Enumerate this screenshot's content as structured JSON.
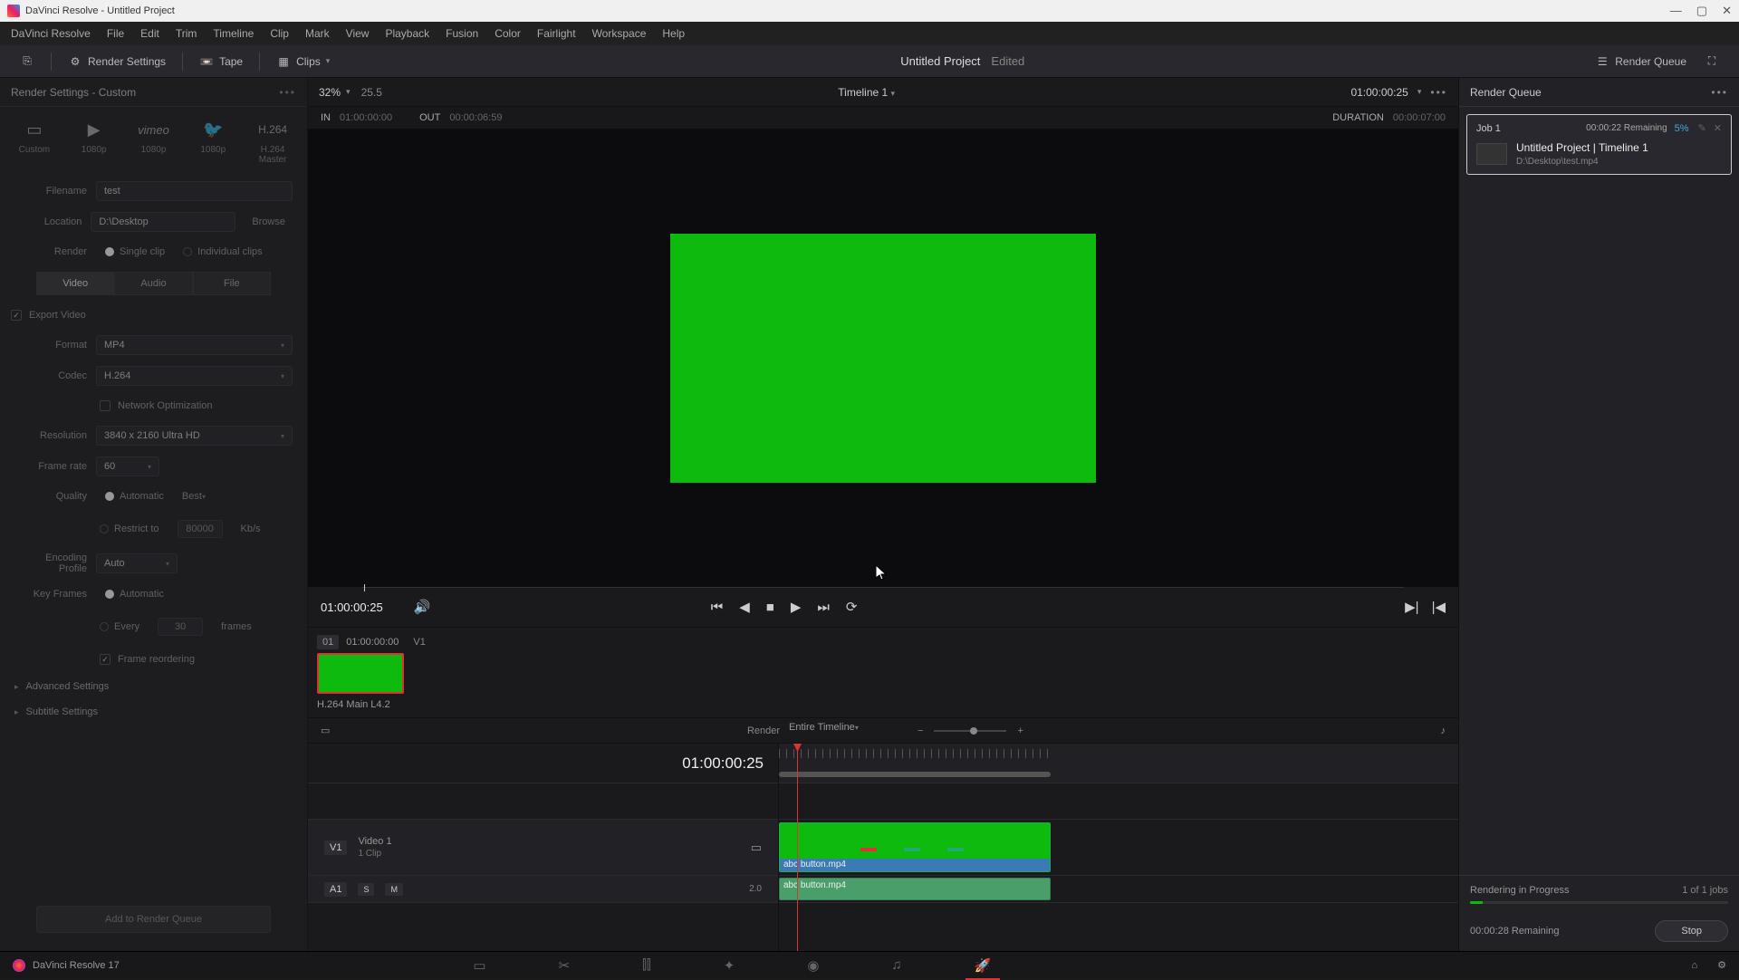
{
  "titlebar": {
    "text": "DaVinci Resolve - Untitled Project"
  },
  "menubar": {
    "app": "DaVinci Resolve",
    "items": [
      "File",
      "Edit",
      "Trim",
      "Timeline",
      "Clip",
      "Mark",
      "View",
      "Playback",
      "Fusion",
      "Color",
      "Fairlight",
      "Workspace",
      "Help"
    ]
  },
  "topbar": {
    "render_settings": "Render Settings",
    "tape": "Tape",
    "clips": "Clips",
    "project": "Untitled Project",
    "edited": "Edited",
    "render_queue": "Render Queue"
  },
  "render_settings": {
    "header": "Render Settings - Custom",
    "presets": [
      "Custom",
      "YouTube",
      "vimeo",
      "Twitter",
      "H.264"
    ],
    "preset_labels": [
      "Custom",
      "1080p",
      "1080p",
      "1080p",
      "H.264 Master"
    ],
    "filename_label": "Filename",
    "filename": "test",
    "location_label": "Location",
    "location": "D:\\Desktop",
    "browse": "Browse",
    "render_label": "Render",
    "single_clip": "Single clip",
    "individual": "Individual clips",
    "tabs": [
      "Video",
      "Audio",
      "File"
    ],
    "export_video": "Export Video",
    "format_label": "Format",
    "format": "MP4",
    "codec_label": "Codec",
    "codec": "H.264",
    "network_opt": "Network Optimization",
    "resolution_label": "Resolution",
    "resolution": "3840 x 2160 Ultra HD",
    "framerate_label": "Frame rate",
    "framerate": "60",
    "quality_label": "Quality",
    "quality_auto": "Automatic",
    "quality_best": "Best",
    "restrict": "Restrict to",
    "restrict_val": "80000",
    "restrict_unit": "Kb/s",
    "encprof_label": "Encoding Profile",
    "encprof": "Auto",
    "keyframes_label": "Key Frames",
    "kf_auto": "Automatic",
    "kf_every": "Every",
    "kf_val": "30",
    "kf_unit": "frames",
    "frame_reorder": "Frame reordering",
    "advanced": "Advanced Settings",
    "subtitle": "Subtitle Settings",
    "add_queue": "Add to Render Queue"
  },
  "viewer": {
    "zoom": "32%",
    "fps": "25.5",
    "timeline_name": "Timeline 1",
    "tc": "01:00:00:25",
    "in_label": "IN",
    "in_tc": "01:00:00:00",
    "out_label": "OUT",
    "out_tc": "00:00:06:59",
    "duration_label": "DURATION",
    "duration": "00:00:07:00",
    "transport_tc": "01:00:00:25",
    "clip_num": "01",
    "clip_tc": "01:00:00:00",
    "clip_track": "V1",
    "clip_label": "H.264 Main L4.2"
  },
  "queue": {
    "header": "Render Queue",
    "job_name": "Job 1",
    "job_remain": "00:00:22 Remaining",
    "job_pct": "5%",
    "job_title": "Untitled Project | Timeline 1",
    "job_path": "D:\\Desktop\\test.mp4",
    "progress_title": "Rendering in Progress",
    "progress_count": "1 of 1 jobs",
    "progress_remaining": "00:00:28 Remaining",
    "stop": "Stop"
  },
  "timeline": {
    "render_label": "Render",
    "render_scope": "Entire Timeline",
    "tc": "01:00:00:25",
    "v1": "V1",
    "v1_name": "Video 1",
    "v1_clips": "1 Clip",
    "a1": "A1",
    "a1_channels": "2.0",
    "clip_name": "abc button.mp4"
  },
  "bottom": {
    "app_version": "DaVinci Resolve 17"
  }
}
